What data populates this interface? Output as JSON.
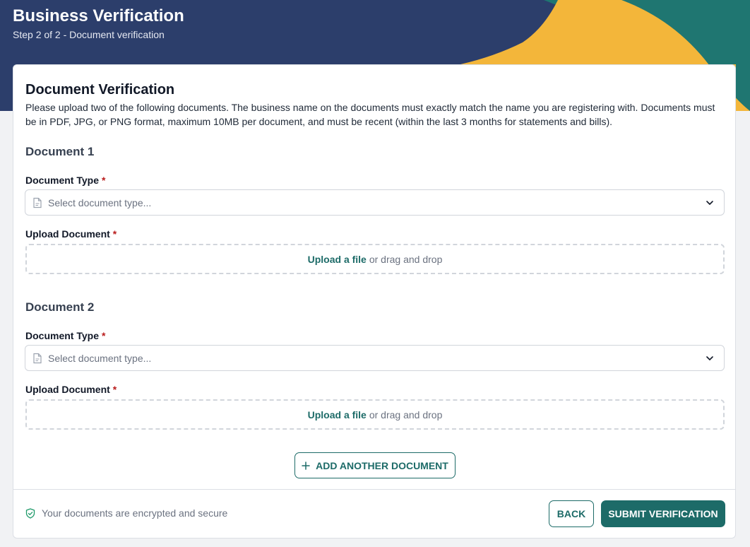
{
  "header": {
    "title": "Business Verification",
    "subtitle": "Step 2 of 2 - Document verification"
  },
  "colors": {
    "header_bg": "#2c3e6b",
    "accent_teal": "#1d6b68",
    "accent_yellow": "#f3b63a",
    "required": "#b91c1c"
  },
  "section": {
    "title": "Document Verification",
    "description": "Please upload two of the following documents. The business name on the documents must exactly match the name you are registering with. Documents must be in PDF, JPG, or PNG format, maximum 10MB per document, and must be recent (within the last 3 months for statements and bills)."
  },
  "documents": [
    {
      "heading": "Document 1",
      "type_label": "Document Type",
      "type_placeholder": "Select document type...",
      "upload_label": "Upload Document",
      "upload_link": "Upload a file",
      "upload_hint": "or drag and drop"
    },
    {
      "heading": "Document 2",
      "type_label": "Document Type",
      "type_placeholder": "Select document type...",
      "upload_label": "Upload Document",
      "upload_link": "Upload a file",
      "upload_hint": "or drag and drop"
    }
  ],
  "required_marker": "*",
  "add_button": "ADD ANOTHER DOCUMENT",
  "footer": {
    "secure_note": "Your documents are encrypted and secure",
    "back_label": "BACK",
    "submit_label": "SUBMIT VERIFICATION"
  },
  "icons": {
    "select_icon": "document-icon",
    "dropdown_icon": "chevron-down-icon",
    "add_icon": "plus-icon",
    "secure_icon": "shield-check-icon"
  }
}
